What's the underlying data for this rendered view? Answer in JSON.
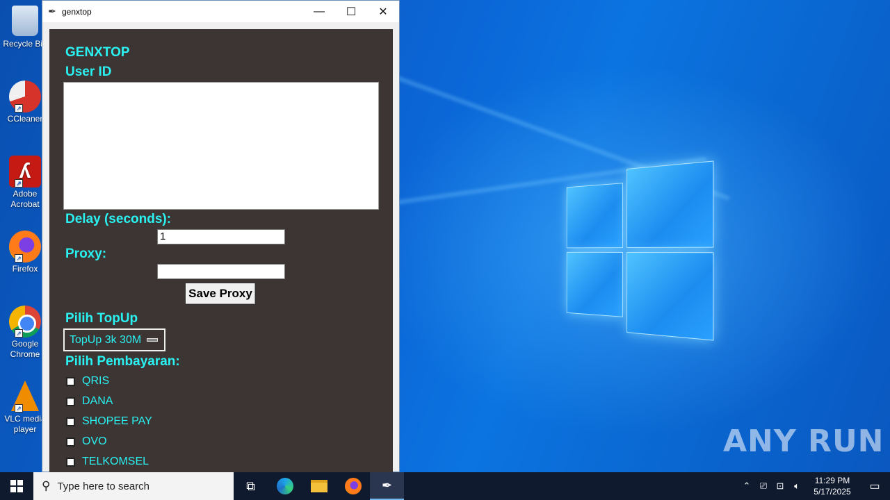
{
  "desktop": {
    "icons": [
      {
        "label": "Recycle Bin",
        "icon": "recycle-bin-icon"
      },
      {
        "label": "CCleaner",
        "icon": "ccleaner-icon"
      },
      {
        "label": "Adobe Acrobat",
        "icon": "acrobat-icon"
      },
      {
        "label": "Firefox",
        "icon": "firefox-icon"
      },
      {
        "label": "Google Chrome",
        "icon": "chrome-icon"
      },
      {
        "label": "VLC media player",
        "icon": "vlc-icon"
      }
    ],
    "watermark": "ANY RUN"
  },
  "window": {
    "title": "genxtop",
    "controls": {
      "minimize": "—",
      "maximize": "☐",
      "close": "✕"
    }
  },
  "app": {
    "heading": "GENXTOP",
    "user_id_label": "User ID",
    "user_id_value": "",
    "delay_label": "Delay (seconds):",
    "delay_value": "1",
    "proxy_label": "Proxy:",
    "proxy_value": "",
    "save_proxy_label": "Save Proxy",
    "topup_label": "Pilih TopUp",
    "topup_selected": "TopUp 3k 30M",
    "payment_label": "Pilih Pembayaran:",
    "payment_options": [
      {
        "label": "QRIS",
        "checked": false
      },
      {
        "label": "DANA",
        "checked": false
      },
      {
        "label": "SHOPEE PAY",
        "checked": false
      },
      {
        "label": "OVO",
        "checked": false
      },
      {
        "label": "TELKOMSEL",
        "checked": false
      }
    ]
  },
  "taskbar": {
    "search_placeholder": "Type here to search",
    "time": "11:29 PM",
    "date": "5/17/2025",
    "apps": [
      "task-view-icon",
      "edge-icon",
      "file-explorer-icon",
      "firefox-icon",
      "genxtop-feather-icon"
    ]
  },
  "colors": {
    "app_bg": "#3c3533",
    "app_text": "#2af2f2",
    "taskbar_bg": "#0f1a2e"
  }
}
